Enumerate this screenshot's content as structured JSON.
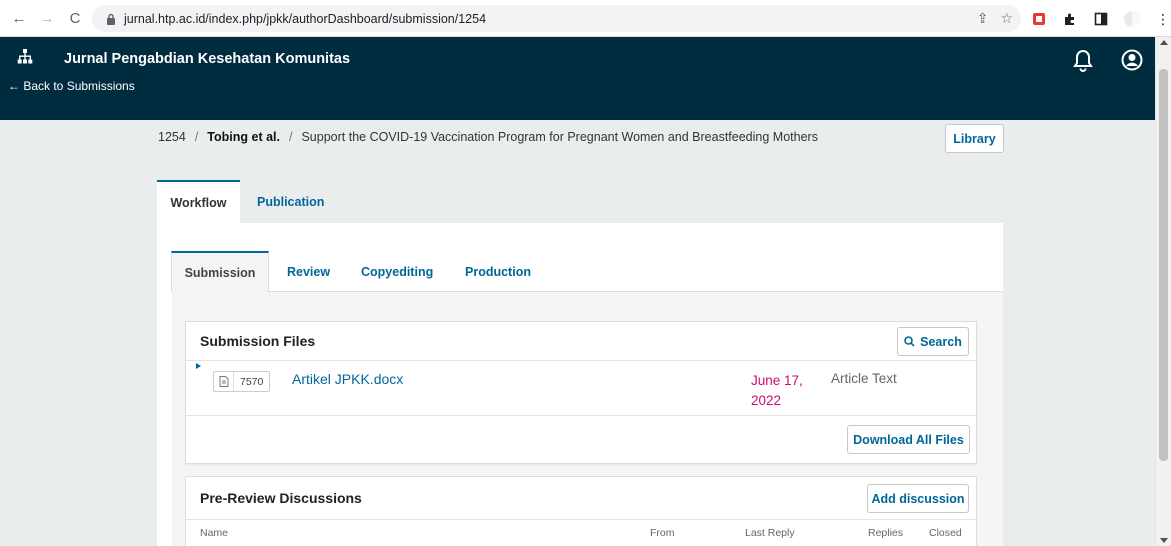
{
  "browser": {
    "url": "jurnal.htp.ac.id/index.php/jpkk/authorDashboard/submission/1254",
    "back_glyph": "←",
    "forward_glyph": "→",
    "reload_glyph": "C",
    "share_glyph": "⇪",
    "star_glyph": "☆",
    "menu_glyph": "⋮"
  },
  "header": {
    "journal_title": "Jurnal Pengabdian Kesehatan Komunitas",
    "back_link": "← Back to Submissions",
    "background_color": "#002c40"
  },
  "submission": {
    "id": "1254",
    "separator": "/",
    "authors": "Tobing et al.",
    "title": "Support the COVID-19 Vaccination Program for Pregnant Women and Breastfeeding Mothers",
    "library_label": "Library"
  },
  "main_tabs": [
    {
      "label": "Workflow",
      "active": true
    },
    {
      "label": "Publication",
      "active": false
    }
  ],
  "sub_tabs": [
    {
      "label": "Submission",
      "active": true
    },
    {
      "label": "Review",
      "active": false
    },
    {
      "label": "Copyediting",
      "active": false
    },
    {
      "label": "Production",
      "active": false
    }
  ],
  "submission_files": {
    "title": "Submission Files",
    "search_label": "Search",
    "files": [
      {
        "id": "7570",
        "name": "Artikel JPKK.docx",
        "date": "June 17, 2022",
        "type": "Article Text"
      }
    ],
    "download_all_label": "Download All Files"
  },
  "discussions": {
    "title": "Pre-Review Discussions",
    "add_label": "Add discussion",
    "columns": [
      "Name",
      "From",
      "Last Reply",
      "Replies",
      "Closed"
    ]
  },
  "colors": {
    "link": "#006798",
    "date": "#d00a6c",
    "page_bg": "#eaedee"
  }
}
